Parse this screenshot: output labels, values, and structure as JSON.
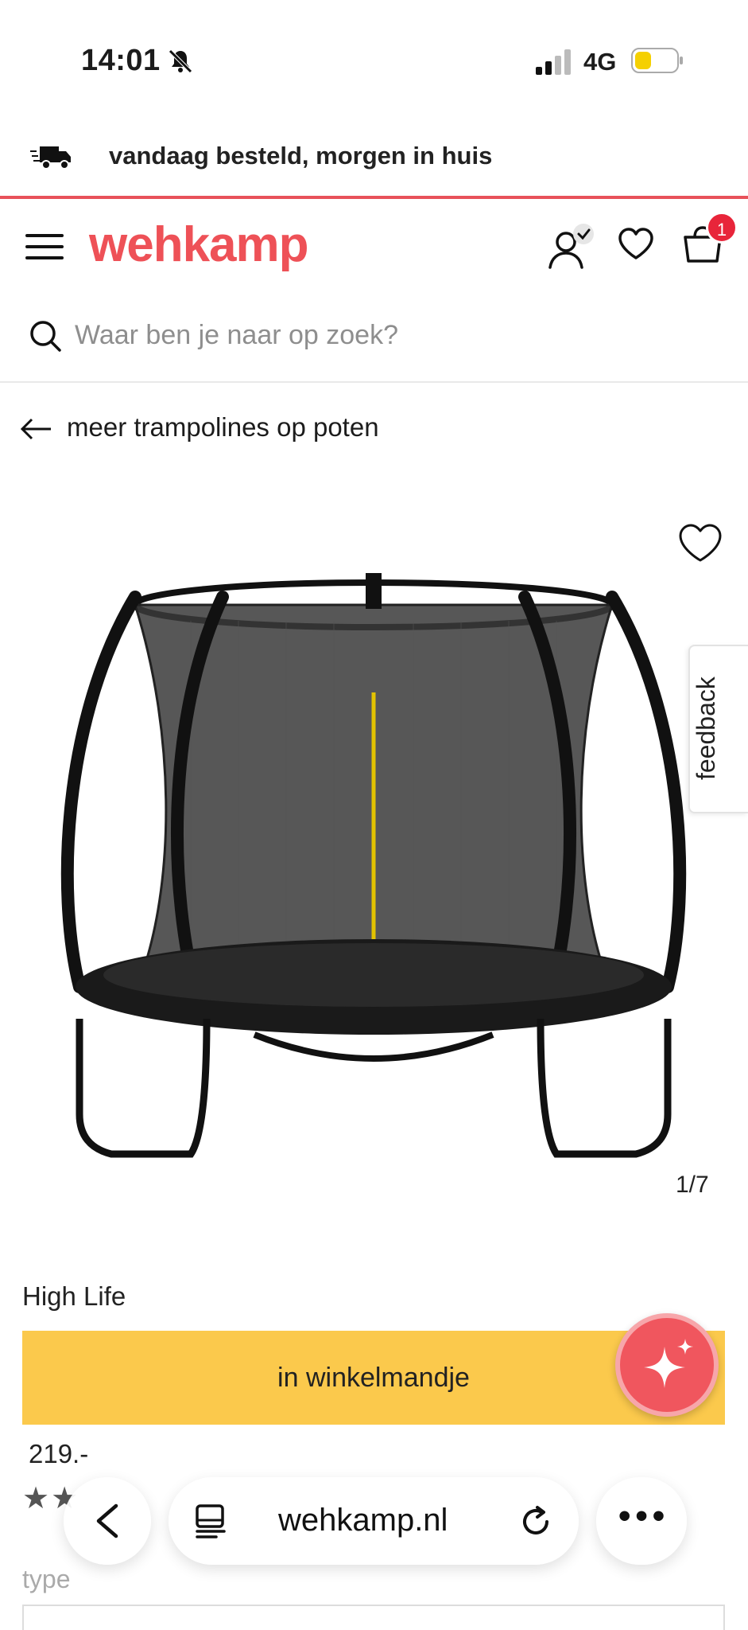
{
  "status_bar": {
    "time": "14:01",
    "network": "4G"
  },
  "promo": {
    "text": "vandaag besteld, morgen in huis"
  },
  "header": {
    "logo": "wehkamp",
    "cart_count": "1"
  },
  "search": {
    "placeholder": "Waar ben je naar op zoek?"
  },
  "back_link": {
    "label": "meer trampolines op poten"
  },
  "gallery": {
    "counter": "1/7",
    "feedback_label": "feedback"
  },
  "product": {
    "brand": "High Life",
    "add_to_cart_label": "in winkelmandje",
    "price": "219.-",
    "type_label": "type"
  },
  "browser": {
    "url": "wehkamp.nl",
    "more_label": "•••"
  },
  "colors": {
    "brand": "#ee5157",
    "cta": "#fbc94c",
    "badge": "#e8253a"
  }
}
